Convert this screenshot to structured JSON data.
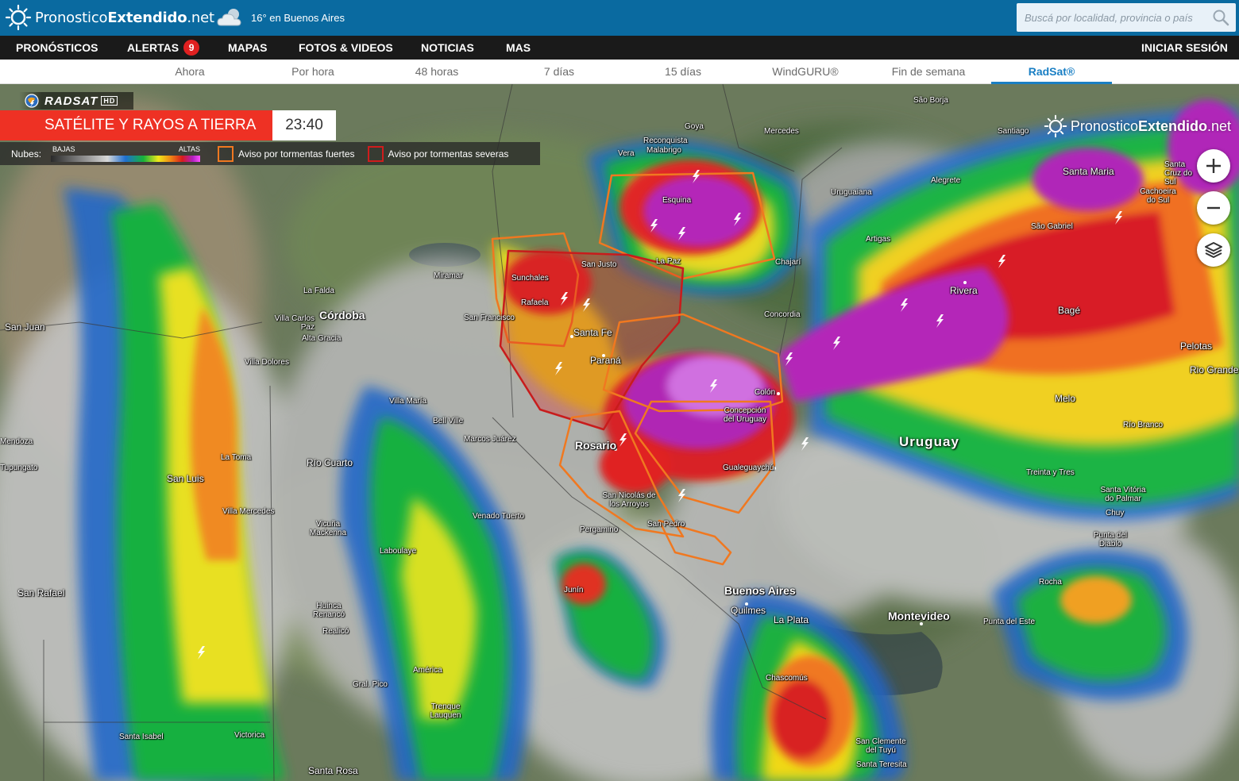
{
  "brand": {
    "name_light": "Pronostico",
    "name_bold": "Extendido",
    "name_tld": ".net"
  },
  "current_weather": {
    "text": "16° en Buenos Aires",
    "icon": "cloudy-icon"
  },
  "search": {
    "placeholder": "Buscá por localidad, provincia o país",
    "icon": "search-icon"
  },
  "main_nav": {
    "items": [
      "PRONÓSTICOS",
      "ALERTAS",
      "MAPAS",
      "FOTOS & VIDEOS",
      "NOTICIAS",
      "MAS"
    ],
    "alerts_count": "9",
    "login": "INICIAR SESIÓN"
  },
  "sub_nav": {
    "tabs": [
      "Ahora",
      "Por hora",
      "48 horas",
      "7 días",
      "15 días",
      "WindGURU®",
      "Fin de semana",
      "RadSat®"
    ],
    "active": "RadSat®"
  },
  "overlay": {
    "product": "RADSAT",
    "product_badge": "HD",
    "title": "SATÉLITE Y RAYOS A TIERRA",
    "time": "23:40",
    "legend_label": "Nubes:",
    "scale_low": "BAJAS",
    "scale_high": "ALTAS",
    "warning_strong": "Aviso por tormentas fuertes",
    "warning_severe": "Aviso por tormentas severas",
    "colors": {
      "strong": "#f07820",
      "severe": "#d01c1c",
      "accent": "#ee3124"
    }
  },
  "map_controls": {
    "zoom_in": "+",
    "zoom_out": "−",
    "layers_icon": "layers-icon"
  },
  "country_label": "Uruguay",
  "cities_major": [
    "Córdoba",
    "Rosario",
    "Buenos Aires",
    "Montevideo",
    "Santa Fe",
    "Paraná",
    "Rivera"
  ],
  "cities": [
    "Goya",
    "Reconquista",
    "Malabrigo",
    "Vera",
    "Mercedes",
    "Esquina",
    "La Paz",
    "San Justo",
    "Sunchales",
    "Rafaela",
    "San Francisco",
    "Miramar",
    "La Falda",
    "Villa Carlos Paz",
    "Alta Gracia",
    "Villa Dolores",
    "San Juan",
    "Villa María",
    "Bell Ville",
    "Marcos Juárez",
    "La Toma",
    "Río Cuarto",
    "San Luis",
    "Villa Mercedes",
    "Vicuña Mackenna",
    "Laboulaye",
    "Venado Tuerto",
    "Pergamino",
    "San Nicolás de los Arroyos",
    "San Pedro",
    "Junín",
    "Huinca Renancó",
    "Realicó",
    "América",
    "Gral. Pico",
    "Trenque Lauquen",
    "Santa Isabel",
    "Victorica",
    "Santa Rosa",
    "San Rafael",
    "Quilmes",
    "La Plata",
    "Chascomús",
    "San Clemente del Tuyú",
    "Santa Teresita",
    "Concordia",
    "Colón",
    "Concepción del Uruguay",
    "Gualeguaychú",
    "Chajarí",
    "Uruguaiana",
    "Artigas",
    "Alegrete",
    "São Borja",
    "Santiago",
    "Santa Maria",
    "São Gabriel",
    "Cachoeira do Sul",
    "Santa Cruz do Sul",
    "Bagé",
    "Pelotas",
    "Rio Grande",
    "Melo",
    "Río Branco",
    "Treinta y Tres",
    "Santa Vitória do Palmar",
    "Chuy",
    "Punta del Diablo",
    "Rocha",
    "Punta del Este",
    "Mendoza",
    "Tupungato"
  ]
}
